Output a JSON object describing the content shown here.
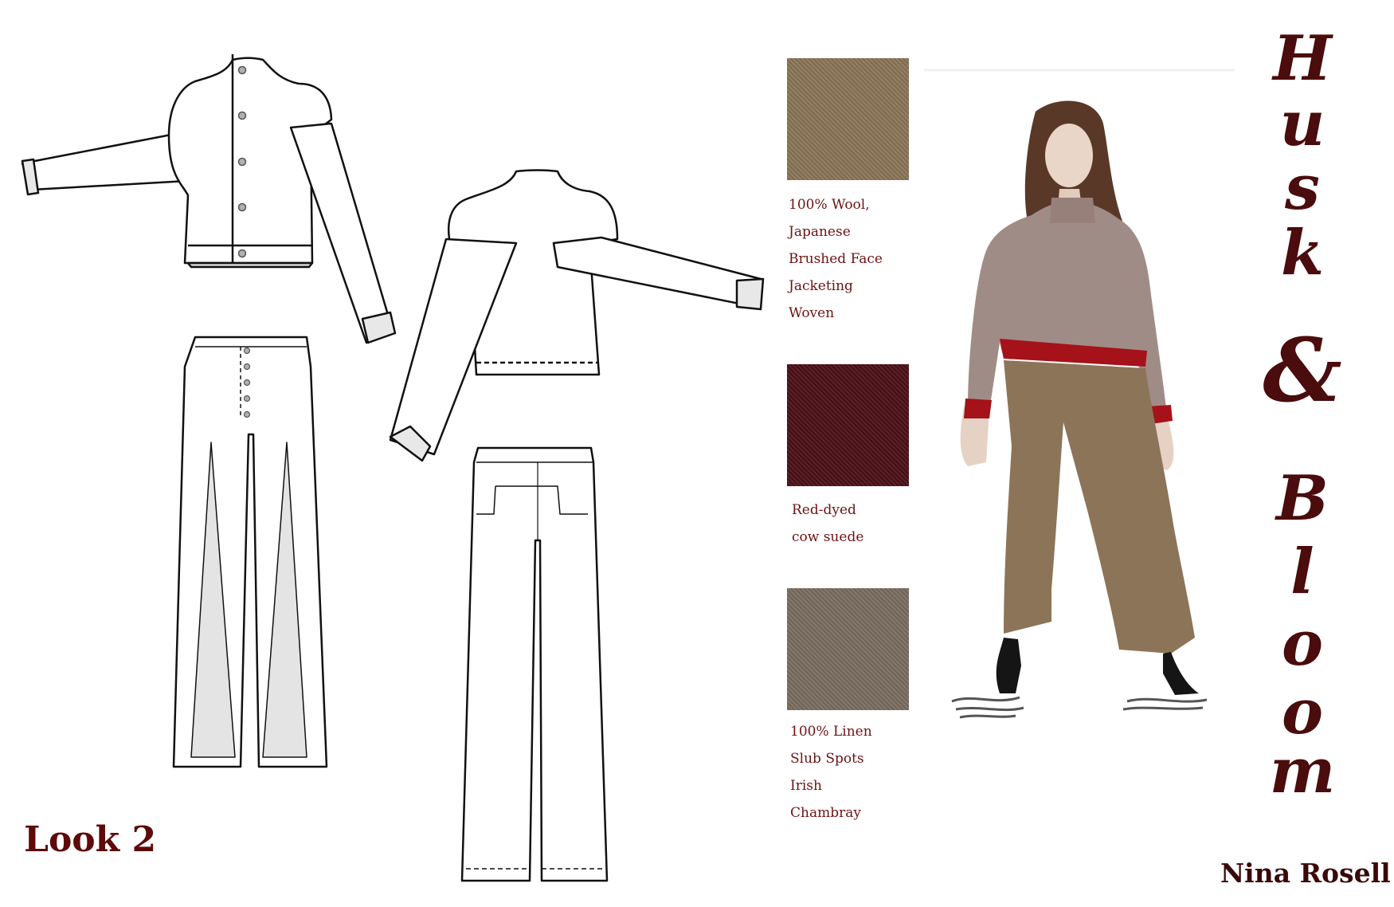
{
  "look": {
    "title": "Look 2"
  },
  "brand": {
    "letters": [
      "H",
      "u",
      "s",
      "k",
      "&",
      "B",
      "l",
      "o",
      "o",
      "m"
    ]
  },
  "designer": {
    "name": "Nina Rosell"
  },
  "fabrics": [
    {
      "name": "wool-swatch",
      "color": "#8a7456",
      "lines": [
        "100% Wool,",
        "Japanese",
        "Brushed Face",
        "Jacketing",
        "Woven"
      ]
    },
    {
      "name": "suede-swatch",
      "color": "#4a0f16",
      "lines": [
        "Red-dyed",
        "cow suede"
      ]
    },
    {
      "name": "linen-swatch",
      "color": "#7a6d60",
      "lines": [
        "100% Linen",
        "Slub Spots",
        "Irish",
        "Chambray"
      ]
    }
  ],
  "colors": {
    "accent": "#6e1212",
    "brand": "#4a0c0c",
    "jacket": "#a08c86",
    "trousers": "#8c7458",
    "trim": "#a5121a"
  }
}
